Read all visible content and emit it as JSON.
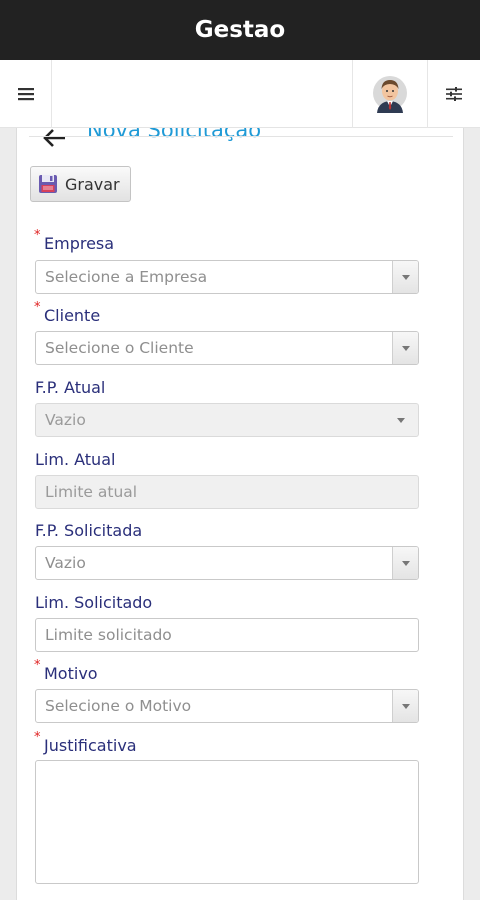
{
  "app": {
    "title": "Gestao"
  },
  "page": {
    "title": "Nova Solicitação"
  },
  "toolbar": {
    "save_label": "Gravar"
  },
  "form": {
    "empresa": {
      "label": "Empresa",
      "value": "Selecione a Empresa",
      "required": true
    },
    "cliente": {
      "label": "Cliente",
      "value": "Selecione o Cliente",
      "required": true
    },
    "fp_atual": {
      "label": "F.P. Atual",
      "value": "Vazio"
    },
    "lim_atual": {
      "label": "Lim. Atual",
      "placeholder": "Limite atual"
    },
    "fp_solicitada": {
      "label": "F.P. Solicitada",
      "value": "Vazio"
    },
    "lim_solicitado": {
      "label": "Lim. Solicitado",
      "placeholder": "Limite solicitado"
    },
    "motivo": {
      "label": "Motivo",
      "value": "Selecione o Motivo",
      "required": true
    },
    "justificativa": {
      "label": "Justificativa",
      "value": "",
      "required": true
    }
  },
  "icons": {
    "menu": "hamburger-icon",
    "avatar": "user-avatar",
    "filter": "sliders-icon",
    "back": "arrow-left-icon",
    "save": "floppy-disk-icon"
  },
  "colors": {
    "title_bar": "#222222",
    "accent": "#1f9ad6",
    "label": "#2a2f7a",
    "required": "#e02020"
  }
}
